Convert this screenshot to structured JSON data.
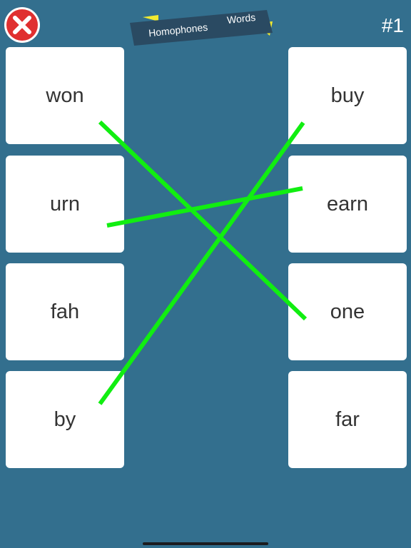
{
  "header": {
    "close_icon": "close-x-icon",
    "banner_left": "Homophones",
    "banner_right": "Words",
    "level": "#1"
  },
  "left_words": [
    "won",
    "urn",
    "fah",
    "by"
  ],
  "right_words": [
    "buy",
    "earn",
    "one",
    "far"
  ],
  "connections": [
    {
      "from": "won",
      "to": "one"
    },
    {
      "from": "urn",
      "to": "earn"
    },
    {
      "from": "by",
      "to": "buy"
    }
  ],
  "colors": {
    "background": "#336f8e",
    "card": "#ffffff",
    "line": "#11ee11",
    "banner": "#2a4a62",
    "banner_accent": "#f0ea30",
    "close": "#e03030"
  }
}
